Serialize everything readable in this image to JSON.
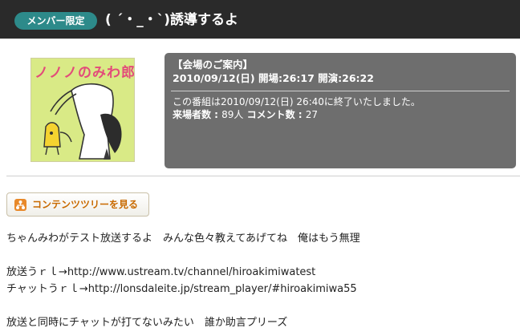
{
  "header": {
    "badge": "メンバー限定",
    "title": "( ´・_・`)誘導するよ"
  },
  "thumbnail": {
    "caption": "ノノノのみわ郎"
  },
  "info": {
    "heading": "【会場のご案内】",
    "date_line": "2010/09/12(日) 開場:26:17 開演:26:22",
    "ended_text": "この番組は2010/09/12(日) 26:40に終了いたしました。",
    "visitors_label": "来場者数 : ",
    "visitors_value": "89人",
    "comments_label": " コメント数 : ",
    "comments_value": "27"
  },
  "content_tree_button": {
    "label": "コンテンツツリーを見る",
    "icon": "tree-icon"
  },
  "description": {
    "line1": "ちゃんみわがテスト放送するよ　みんな色々教えてあげてね　俺はもう無理",
    "line2": "放送うｒｌ→http://www.ustream.tv/channel/hiroakimiwatest",
    "line3": "チャットうｒｌ→http://lonsdaleite.jp/stream_player/#hiroakimiwa55",
    "line4": "放送と同時にチャットが打てないみたい　誰か助言プリーズ"
  },
  "colors": {
    "header_bg": "#2a2a2a",
    "badge_bg": "#2d8a8a",
    "info_bg": "#6e6e6e",
    "button_text": "#c86a00"
  }
}
